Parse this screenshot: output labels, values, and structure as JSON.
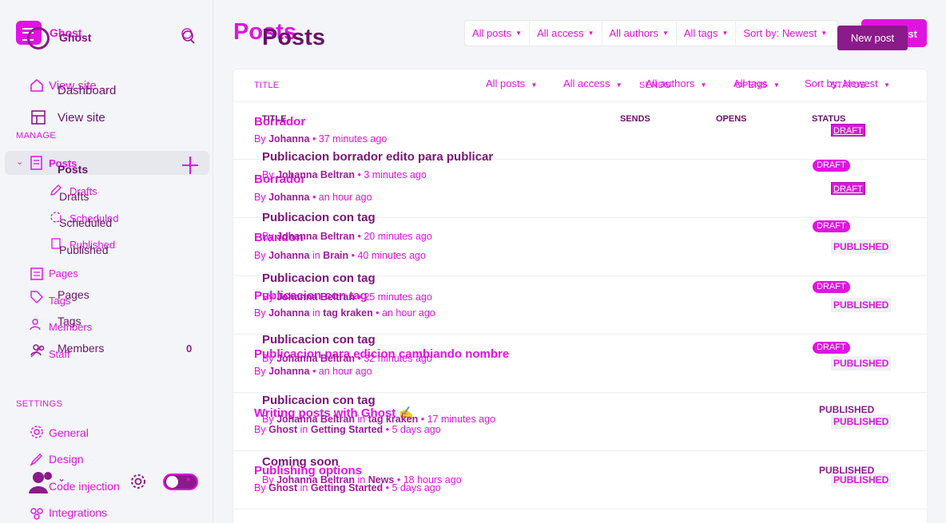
{
  "brand": {
    "name_primary": "Ghost",
    "name_secondary": "Ghost"
  },
  "sidebar": {
    "top_items_a": [
      {
        "label": "View site",
        "icon": "home-icon"
      }
    ],
    "top_items_b": [
      {
        "label": "Dashboard",
        "icon": "home-icon"
      },
      {
        "label": "View site",
        "icon": "layout-icon"
      }
    ],
    "manage_label": "MANAGE",
    "posts_a": "Posts",
    "posts_b": "Posts",
    "sub_a": [
      "Drafts",
      "Scheduled",
      "Published"
    ],
    "sub_b": [
      "Drafts",
      "Scheduled",
      "Published"
    ],
    "list_a": [
      "Pages",
      "Tags",
      "Members",
      "Staff"
    ],
    "list_b": [
      "Pages",
      "Tags",
      "Members"
    ],
    "members_count": "0",
    "settings_label": "SETTINGS",
    "settings_items": [
      "General",
      "Design",
      "Code injection",
      "Integrations"
    ]
  },
  "header": {
    "title_a": "Posts",
    "title_b": "Posts",
    "filters": [
      "All posts",
      "All access",
      "All authors",
      "All tags",
      "Sort by: Newest"
    ],
    "new_post_a": "New post",
    "new_post_b": "New post"
  },
  "table": {
    "head_title_a": "TITLE",
    "filters_b": [
      "All posts",
      "All access",
      "All authors",
      "All tags",
      "Sort by: Newest"
    ],
    "head_sends_a": "SENDS",
    "head_opens_a": "OPENS",
    "head_status_a": "STATUS",
    "head_title_b": "TITLE",
    "head_sends_b": "SENDS",
    "head_opens_b": "OPENS",
    "head_status_b": "STATUS",
    "rows_a": [
      {
        "title": "Borrador",
        "author": "Johanna",
        "in": "",
        "tag": "",
        "time": "37 minutes ago",
        "status": "DRAFT"
      },
      {
        "title": "Borrador",
        "author": "Johanna",
        "in": "",
        "tag": "",
        "time": "an hour ago",
        "status": "DRAFT"
      },
      {
        "title": "Brandon",
        "author": "Johanna",
        "in": "in",
        "tag": "Brain",
        "time": "40 minutes ago",
        "status": "PUBLISHED"
      },
      {
        "title": "Publicacion con tag",
        "author": "Johanna",
        "in": "in",
        "tag": "tag kraken",
        "time": "an hour ago",
        "status": "PUBLISHED"
      },
      {
        "title": "Publicacion para edicion cambiando nombre",
        "author": "Johanna",
        "in": "",
        "tag": "",
        "time": "an hour ago",
        "status": "PUBLISHED"
      },
      {
        "title": "Writing posts with Ghost ✍️",
        "author": "Ghost",
        "in": "in",
        "tag": "Getting Started",
        "time": "5 days ago",
        "status": "PUBLISHED"
      },
      {
        "title": "Publishing options",
        "author": "Ghost",
        "in": "in",
        "tag": "Getting Started",
        "time": "5 days ago",
        "status": "PUBLISHED"
      }
    ],
    "rows_b": [
      {
        "title": "Publicacion borrador edito para publicar",
        "author": "Johanna Beltran",
        "in": "",
        "tag": "",
        "time": "3 minutes ago",
        "status": "DRAFT"
      },
      {
        "title": "Publicacion con tag",
        "author": "Johanna Beltran",
        "in": "",
        "tag": "",
        "time": "20 minutes ago",
        "status": "DRAFT"
      },
      {
        "title": "Publicacion con tag",
        "author": "Johanna Beltran",
        "in": "",
        "tag": "",
        "time": "25 minutes ago",
        "status": "DRAFT"
      },
      {
        "title": "Publicacion con tag",
        "author": "Johanna Beltran",
        "in": "",
        "tag": "",
        "time": "32 minutes ago",
        "status": "DRAFT"
      },
      {
        "title": "Publicacion con tag",
        "author": "Johanna Beltran",
        "in": "in",
        "tag": "tag kraken",
        "time": "17 minutes ago",
        "status": "PUBLISHED"
      },
      {
        "title": "Coming soon",
        "author": "Johanna Beltran",
        "in": "in",
        "tag": "News",
        "time": "18 hours ago",
        "status": "PUBLISHED"
      }
    ]
  },
  "colors": {
    "accent": "#e014e0",
    "accent_dark": "#8b1a8b",
    "text_dark": "#6a1068",
    "background": "#f4f5f8"
  }
}
